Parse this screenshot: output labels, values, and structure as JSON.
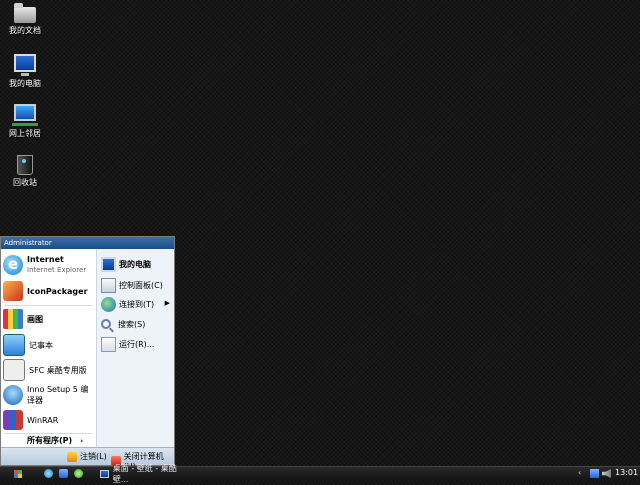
{
  "desktop": {
    "icons": [
      {
        "label": "我的文档",
        "icon": "folder-icon"
      },
      {
        "label": "我的电脑",
        "icon": "computer-icon"
      },
      {
        "label": "网上邻居",
        "icon": "network-icon"
      },
      {
        "label": "回收站",
        "icon": "recycle-bin-icon"
      }
    ]
  },
  "start_menu": {
    "user": "Administrator",
    "pinned": [
      {
        "label": "Internet",
        "sub": "Internet Explorer",
        "icon": "internet-explorer-icon"
      },
      {
        "label": "IconPackager",
        "icon": "iconpackager-icon"
      }
    ],
    "programs": [
      {
        "label": "画图",
        "icon": "paint-icon"
      },
      {
        "label": "记事本",
        "icon": "notepad-icon"
      },
      {
        "label": "SFC 桌酷专用版",
        "icon": "sfc-icon"
      },
      {
        "label": "Inno Setup 5 编译器",
        "icon": "inno-setup-icon"
      },
      {
        "label": "WinRAR",
        "icon": "winrar-icon"
      }
    ],
    "all_programs": "所有程序(P)",
    "right": [
      {
        "label": "我的电脑",
        "icon": "computer-icon"
      },
      {
        "label": "控制面板(C)",
        "icon": "control-panel-icon"
      },
      {
        "label": "连接到(T)",
        "icon": "connect-icon",
        "submenu": true
      },
      {
        "label": "搜索(S)",
        "icon": "search-icon"
      },
      {
        "label": "运行(R)...",
        "icon": "run-icon"
      }
    ],
    "footer": {
      "logoff": "注销(L)",
      "shutdown": "关闭计算机(U)"
    }
  },
  "taskbar": {
    "task_button": "桌面 - 壁纸 - 桌酷壁...",
    "tray_arrow": "‹",
    "clock": "13:01",
    "colors": {
      "background": "#1e1e1e",
      "start_menu_header": "#2a5d96"
    }
  }
}
